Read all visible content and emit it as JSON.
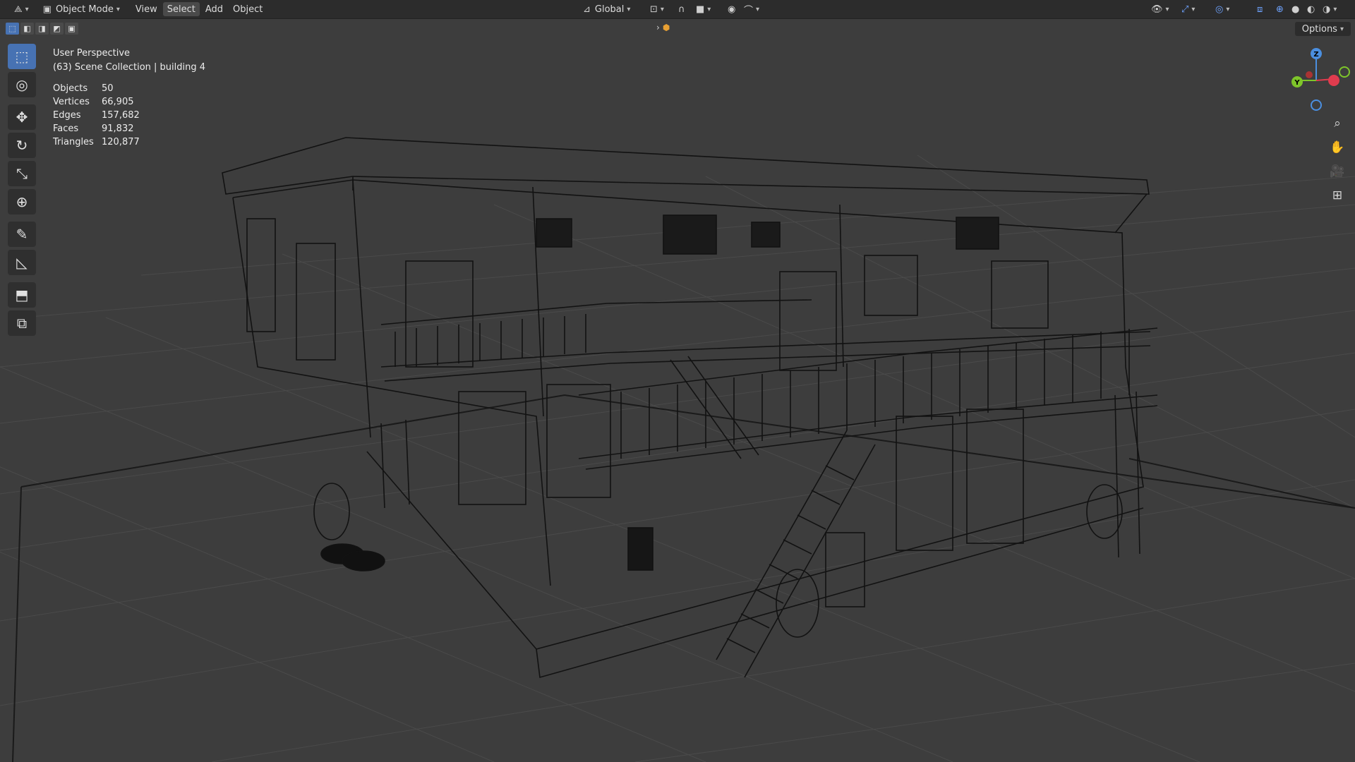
{
  "header": {
    "editor_icon": "3d-viewport-icon",
    "mode_label": "Object Mode",
    "menus": [
      "View",
      "Select",
      "Add",
      "Object"
    ],
    "selected_menu": "Select",
    "transform_orientation": "Global",
    "options_label": "Options"
  },
  "overlay": {
    "perspective": "User Perspective",
    "collection": "(63) Scene Collection | building 4"
  },
  "stats": [
    {
      "label": "Objects",
      "value": "50"
    },
    {
      "label": "Vertices",
      "value": "66,905"
    },
    {
      "label": "Edges",
      "value": "157,682"
    },
    {
      "label": "Faces",
      "value": "91,832"
    },
    {
      "label": "Triangles",
      "value": "120,877"
    }
  ],
  "toolbar": [
    {
      "name": "select-box-icon",
      "glyph": "⬚"
    },
    {
      "name": "cursor-icon",
      "glyph": "◎"
    },
    {
      "name": "move-icon",
      "glyph": "✥"
    },
    {
      "name": "rotate-icon",
      "glyph": "↻"
    },
    {
      "name": "scale-icon",
      "glyph": "⤡"
    },
    {
      "name": "transform-icon",
      "glyph": "⊕"
    },
    {
      "name": "annotate-icon",
      "glyph": "✎"
    },
    {
      "name": "measure-icon",
      "glyph": "📐"
    },
    {
      "name": "add-cube-icon",
      "glyph": "⬒"
    },
    {
      "name": "primitive-icon",
      "glyph": "⧉"
    }
  ],
  "gizmo": {
    "z": "Z",
    "y": "Y",
    "x_color": "#e03c4e",
    "y_color": "#7ec52a",
    "z_color": "#4b8fe0"
  },
  "colors": {
    "accent": "#4772b3",
    "grid": "#4a4a4a",
    "wire": "#121212"
  }
}
